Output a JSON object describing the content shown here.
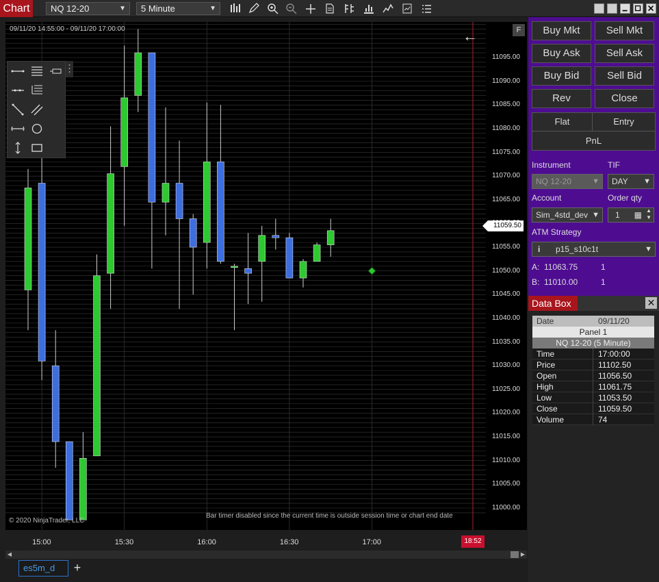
{
  "app": {
    "title": "Chart"
  },
  "toolbar": {
    "instrument": "NQ 12-20",
    "interval": "5 Minute",
    "icons": [
      "bar-type-icon",
      "draw-pencil-icon",
      "zoom-in-icon",
      "zoom-out-icon",
      "crosshair-icon",
      "data-series-icon",
      "indicators-icon",
      "strategies-icon",
      "chart-trader-icon",
      "properties-icon",
      "templates-icon"
    ]
  },
  "chart": {
    "range_label": "09/11/20 14:55:00 - 09/11/20 17:00:00",
    "copyright": "© 2020 NinjaTrader, LLC",
    "bar_timer_msg": "Bar timer disabled since the current time is outside session time or chart end date",
    "last_price": "11059.50",
    "timer_badge": "18:52",
    "f_button": "F",
    "price_ticks": [
      "11095.00",
      "11090.00",
      "11085.00",
      "11080.00",
      "11075.00",
      "11070.00",
      "11065.00",
      "11060.00",
      "11055.00",
      "11050.00",
      "11045.00",
      "11040.00",
      "11035.00",
      "11030.00",
      "11025.00",
      "11020.00",
      "11015.00",
      "11010.00",
      "11005.00",
      "11000.00"
    ],
    "time_ticks": [
      "15:00",
      "15:30",
      "16:00",
      "16:30",
      "17:00"
    ],
    "up_color": "#2ec830",
    "down_color": "#3d6ee0"
  },
  "chart_data": {
    "type": "candlestick",
    "xlabel": "",
    "ylabel": "",
    "ylim": [
      10997.5,
      11100
    ],
    "bars": [
      {
        "time": "14:55",
        "open": 11046.0,
        "high": 11071.5,
        "low": 11037.5,
        "close": 11067.5
      },
      {
        "time": "15:00",
        "open": 11068.5,
        "high": 11075.0,
        "low": 11027.0,
        "close": 11031.0
      },
      {
        "time": "15:05",
        "open": 11030.0,
        "high": 11037.5,
        "low": 11008.5,
        "close": 11014.0
      },
      {
        "time": "15:10",
        "open": 11014.0,
        "high": 11014.0,
        "low": 10997.5,
        "close": 10997.5
      },
      {
        "time": "15:15",
        "open": 10997.5,
        "high": 11016.0,
        "low": 10997.5,
        "close": 11010.5
      },
      {
        "time": "15:20",
        "open": 11011.0,
        "high": 11053.5,
        "low": 11011.0,
        "close": 11049.0
      },
      {
        "time": "15:25",
        "open": 11049.5,
        "high": 11080.5,
        "low": 11042.0,
        "close": 11070.5
      },
      {
        "time": "15:30",
        "open": 11072.0,
        "high": 11097.5,
        "low": 11059.5,
        "close": 11086.5
      },
      {
        "time": "15:35",
        "open": 11087.0,
        "high": 11101.0,
        "low": 11083.5,
        "close": 11096.0
      },
      {
        "time": "15:40",
        "open": 11096.0,
        "high": 11096.0,
        "low": 11050.5,
        "close": 11064.5
      },
      {
        "time": "15:45",
        "open": 11064.5,
        "high": 11084.5,
        "low": 11057.5,
        "close": 11068.5
      },
      {
        "time": "15:50",
        "open": 11068.5,
        "high": 11077.5,
        "low": 11042.0,
        "close": 11061.0
      },
      {
        "time": "15:55",
        "open": 11061.0,
        "high": 11062.0,
        "low": 11045.0,
        "close": 11055.0
      },
      {
        "time": "16:00",
        "open": 11056.0,
        "high": 11085.5,
        "low": 11050.5,
        "close": 11073.0
      },
      {
        "time": "16:05",
        "open": 11073.0,
        "high": 11085.0,
        "low": 11051.5,
        "close": 11052.0
      },
      {
        "time": "16:10",
        "open": 11051.0,
        "high": 11051.5,
        "low": 11037.5,
        "close": 11051.0
      },
      {
        "time": "16:15",
        "open": 11050.5,
        "high": 11058.0,
        "low": 11043.0,
        "close": 11049.5
      },
      {
        "time": "16:20",
        "open": 11052.0,
        "high": 11059.5,
        "low": 11043.5,
        "close": 11057.5
      },
      {
        "time": "16:25",
        "open": 11057.5,
        "high": 11061.0,
        "low": 11054.5,
        "close": 11057.0
      },
      {
        "time": "16:30",
        "open": 11057.0,
        "high": 11058.0,
        "low": 11048.5,
        "close": 11048.5
      },
      {
        "time": "16:35",
        "open": 11048.5,
        "high": 11052.5,
        "low": 11046.5,
        "close": 11052.0
      },
      {
        "time": "16:40",
        "open": 11052.0,
        "high": 11056.0,
        "low": 11052.0,
        "close": 11055.5
      },
      {
        "time": "16:45",
        "open": 11055.5,
        "high": 11061.0,
        "low": 11053.0,
        "close": 11058.5
      }
    ]
  },
  "chart_trader": {
    "buttons": {
      "buy_mkt": "Buy Mkt",
      "sell_mkt": "Sell Mkt",
      "buy_ask": "Buy Ask",
      "sell_ask": "Sell Ask",
      "buy_bid": "Buy Bid",
      "sell_bid": "Sell Bid",
      "rev": "Rev",
      "close": "Close",
      "flat": "Flat",
      "entry": "Entry",
      "pnl": "PnL"
    },
    "labels": {
      "instrument": "Instrument",
      "tif": "TIF",
      "account": "Account",
      "order_qty": "Order qty",
      "atm": "ATM Strategy"
    },
    "fields": {
      "instrument": "NQ 12-20",
      "tif": "DAY",
      "account": "Sim_4std_dev",
      "order_qty": "1",
      "atm": "p15_s10c1t"
    },
    "ask": {
      "label": "A:",
      "price": "11063.75",
      "size": "1"
    },
    "bid": {
      "label": "B:",
      "price": "11010.00",
      "size": "1"
    }
  },
  "databox": {
    "title": "Data Box",
    "date_key": "Date",
    "date_val": "09/11/20",
    "panel": "Panel 1",
    "series": "NQ 12-20 (5 Minute)",
    "rows": [
      {
        "k": "Time",
        "v": "17:00:00"
      },
      {
        "k": "Price",
        "v": "11102.50"
      },
      {
        "k": "Open",
        "v": "11056.50"
      },
      {
        "k": "High",
        "v": "11061.75"
      },
      {
        "k": "Low",
        "v": "11053.50"
      },
      {
        "k": "Close",
        "v": "11059.50"
      },
      {
        "k": "Volume",
        "v": "74"
      }
    ]
  },
  "tabs": {
    "active": "es5m_d",
    "add": "+"
  }
}
